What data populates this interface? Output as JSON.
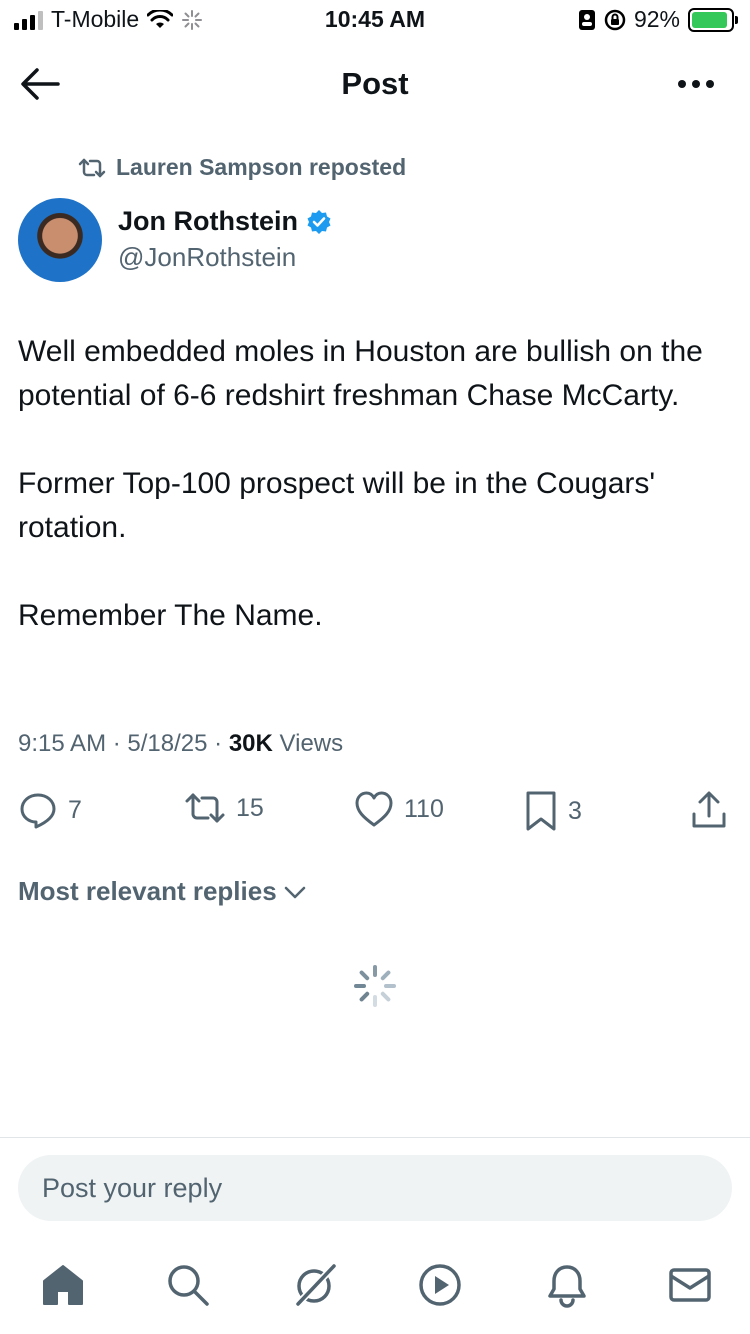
{
  "status_bar": {
    "carrier": "T-Mobile",
    "time": "10:45 AM",
    "battery_percent": "92%",
    "battery_level": 0.92,
    "icons": [
      "signal-icon",
      "wifi-icon",
      "activity-icon",
      "portrait-lock-icon",
      "rotation-lock-icon",
      "battery-charging-icon"
    ]
  },
  "header": {
    "title": "Post",
    "back_icon": "back-arrow-icon",
    "more_icon": "more-icon"
  },
  "repost": {
    "text": "Lauren Sampson reposted",
    "icon": "repost-icon"
  },
  "author": {
    "name": "Jon Rothstein",
    "handle": "@JonRothstein",
    "verified": true,
    "verified_color": "#1d9bf0"
  },
  "post": {
    "text": "Well embedded moles in Houston are bullish on the potential of 6-6 redshirt freshman Chase McCarty.\n\nFormer Top-100 prospect will be in the Cougars' rotation.\n\nRemember The Name.",
    "time": "9:15 AM",
    "date": "5/18/25",
    "separator": "·",
    "views_count": "30K",
    "views_label": "Views"
  },
  "actions": {
    "replies": "7",
    "reposts": "15",
    "likes": "110",
    "bookmarks": "3"
  },
  "replies_sort": {
    "label": "Most relevant replies"
  },
  "reply_box": {
    "placeholder": "Post your reply"
  },
  "bottom_nav": {
    "items": [
      "home-icon",
      "search-icon",
      "grok-icon",
      "video-icon",
      "notifications-icon",
      "messages-icon"
    ]
  },
  "colors": {
    "text": "#0f1419",
    "secondary": "#536471",
    "accent": "#1d9bf0",
    "battery": "#34c759"
  }
}
